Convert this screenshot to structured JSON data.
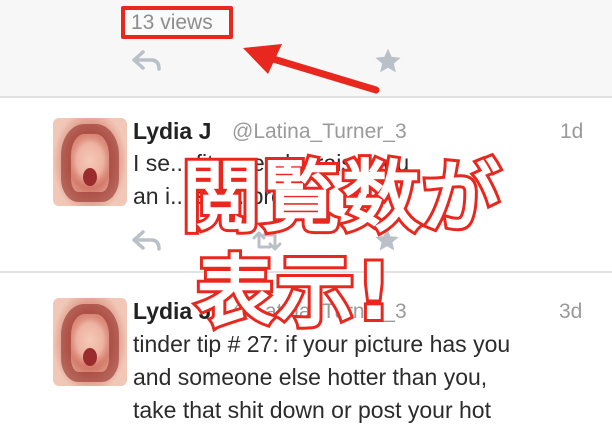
{
  "tweet_top": {
    "views_label": "13 views"
  },
  "tweets": [
    {
      "name": "Lydia J",
      "handle": "@Latina_Turner_3",
      "time": "1d",
      "lines": [
        "I se... fit... need... raise you",
        "an i... scr... pro... or"
      ]
    },
    {
      "name": "Lydia J",
      "handle": "@Latina_Turner_3",
      "time": "3d",
      "lines": [
        "tinder tip # 27:  if your picture has you",
        "and someone else hotter than you,",
        "take that shit down   or post your hot"
      ]
    }
  ],
  "overlay": {
    "line1": "閲覧数が",
    "line2": "表示!"
  },
  "colors": {
    "highlight": "#e8281e",
    "icon_gray": "#b9c0c8"
  },
  "icons": [
    "reply-icon",
    "retweet-icon",
    "favorite-star-icon"
  ]
}
